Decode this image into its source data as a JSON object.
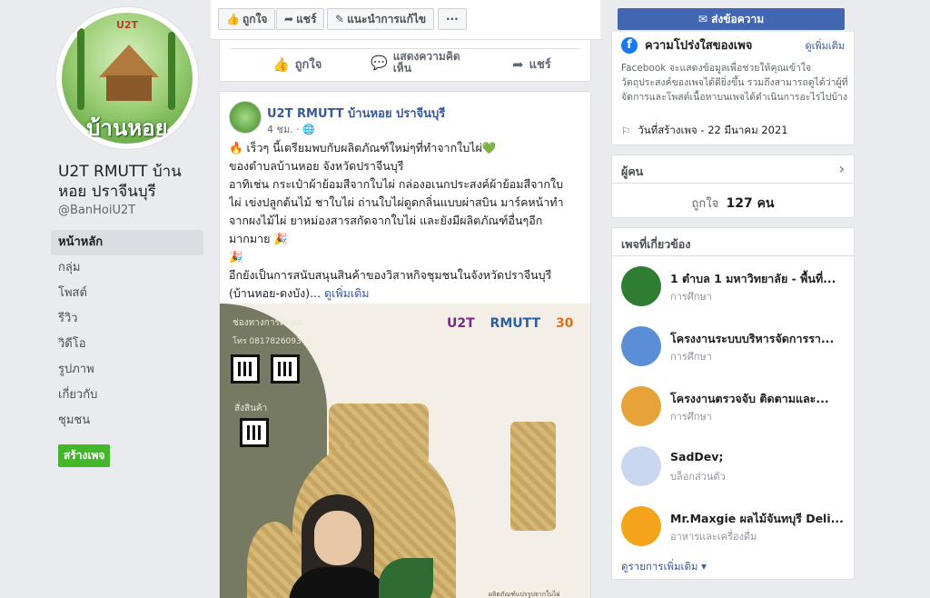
{
  "page": {
    "name": "U2T RMUTT บ้านหอย ปราจีนบุรี",
    "handle": "@BanHoiU2T",
    "logo_text": "บ้านหอย",
    "logo_brand": "U2T"
  },
  "nav": {
    "items": [
      "หน้าหลัก",
      "กลุ่ม",
      "โพสต์",
      "รีวิว",
      "วิดีโอ",
      "รูปภาพ",
      "เกี่ยวกับ",
      "ชุมชน"
    ],
    "create_label": "สร้างเพจ"
  },
  "actionbar": {
    "like": "ถูกใจ",
    "share": "แชร์",
    "suggest": "แนะนำการแก้ไข",
    "more": "···"
  },
  "prev_post_actions": {
    "like": "ถูกใจ",
    "comment": "แสดงความคิดเห็น",
    "share": "แชร์"
  },
  "post": {
    "author": "U2T RMUTT บ้านหอย ปราจีนบุรี",
    "time": "4 ชม. · 🌐",
    "lines": [
      "🔥 เร็วๆ นี้เตรียมพบกับผลิตภัณฑ์ใหม่ๆที่ทำจากใบไผ่💚",
      "ของตำบลบ้านหอย จังหวัดปราจีนบุรี",
      "อาทิเช่น กระเป๋าผ้าย้อมสีจากใบไผ่ กล่องอเนกประสงค์ผ้าย้อมสีจากใบ",
      "ไผ่ เข่งปลูกต้นไม้ ชาใบไผ่ ถ่านใบไผ่ดูดกลิ่นแบบผ่าสบิน มาร์คหน้าทำ",
      "จากผงไม้ไผ่ ยาหม่องสารสกัดจากใบไผ่ และยังมีผลิตภัณฑ์อื่นๆอีก",
      "มากมาย 🎉",
      "🎉",
      "อีกยังเป็นการสนับสนุนสินค้าของวิสาหกิจชุมชนในจังหวัดปราจีนบุรี"
    ],
    "last_line": "(บ้านหอย-ดงบัง)...",
    "see_more": "ดูเพิ่มเติม",
    "image": {
      "contact": "ช่องทางการติดต่อ",
      "phone": "โทร 0817826093",
      "product": "สั่งสินค้า",
      "logo1": "U2T",
      "logo2": "RMUTT",
      "logo3": "30",
      "caption": "ผลิตภัณฑ์แปรรูปจากใบไผ่ ภูมิปัญญาท้องถิ่น สินค้าที่เป็นมิตรกับสิ่งแวดล้อม มีความทนทาน"
    }
  },
  "sidebar": {
    "send_message": "ส่งข้อความ",
    "about_title": "ความโปร่งใสของเพจ",
    "about_more": "ดูเพิ่มเติม",
    "about_desc": "Facebook จะแสดงข้อมูลเพื่อช่วยให้คุณเข้าใจวัตถุประสงค์ของเพจได้ดียิ่งขึ้น รวมถึงสามารถดูได้ว่าผู้ที่จัดการและโพสต์เนื้อหาบนเพจได้ดำเนินการอะไรไปบ้าง",
    "created": "วันที่สร้างเพจ - 22 มีนาคม 2021",
    "people_title": "ผู้คน",
    "likes_prefix": "ถูกใจ",
    "likes_count": "127 คน",
    "related_title": "เพจที่เกี่ยวข้อง",
    "related": [
      {
        "name": "1 ตำบล 1 มหาวิทยาลัย - พื้นที่...",
        "category": "การศึกษา",
        "color": "#2e7d32"
      },
      {
        "name": "โครงงานระบบบริหารจัดการรา...",
        "category": "การศึกษา",
        "color": "#5a8fd8"
      },
      {
        "name": "โครงงานตรวจจับ ติดตามและ...",
        "category": "การศึกษา",
        "color": "#e8a23a"
      },
      {
        "name": "SadDev;",
        "category": "บล็อกส่วนตัว",
        "color": "#c9d8f0"
      },
      {
        "name": "Mr.Maxgie ผลไม้จันทบุรี Deli...",
        "category": "อาหารและเครื่องดื่ม",
        "color": "#f4a41a"
      }
    ],
    "related_more": "ดูรายการเพิ่มเติม ▾"
  }
}
